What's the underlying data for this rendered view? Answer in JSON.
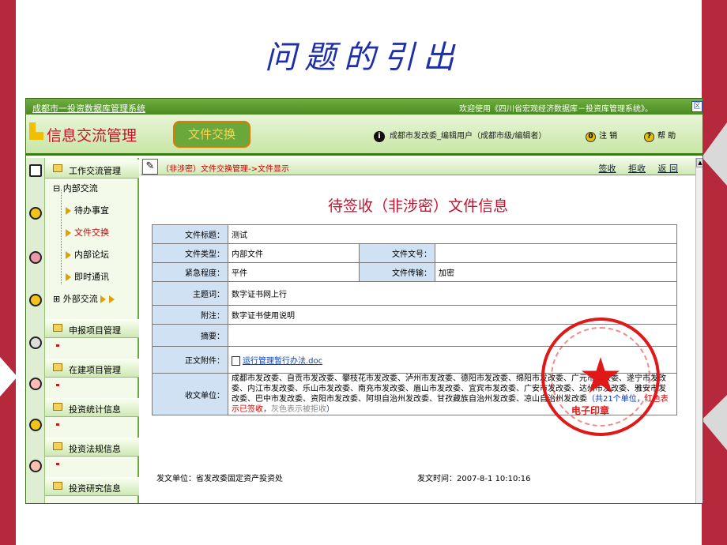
{
  "slide": {
    "title": "问题的引出"
  },
  "topbar": {
    "system_link": "成都市一投资数据库管理系统",
    "welcome": "欢迎使用《四川省宏观经济数据库－投资库管理系统》。",
    "window_btn": "区"
  },
  "header": {
    "app_title": "信息交流管理",
    "tab_label": "文件交换",
    "user_info": "成都市发改委_编辑用户（成都市级/编辑者）",
    "logout": "注 销",
    "help": "帮 助",
    "info_glyph": "i",
    "logout_glyph": "0",
    "help_glyph": "?"
  },
  "sidebar": {
    "groups": [
      "工作交流管理",
      "申报项目管理",
      "在建项目管理",
      "投资统计信息",
      "投资法规信息",
      "投资研究信息"
    ],
    "tree": {
      "internal": "内部交流",
      "items": [
        "待办事宜",
        "文件交换",
        "内部论坛",
        "即时通讯"
      ],
      "external": "外部交流"
    }
  },
  "crumbbar": {
    "breadcrumb": "（非涉密）文件交换管理->文件显示",
    "actions": [
      "签收",
      "拒收",
      "返 回"
    ]
  },
  "document": {
    "heading": "待签收（非涉密）文件信息",
    "rows": {
      "title_label": "文件标题：",
      "title_value": "测试",
      "type_label": "文件类型：",
      "type_value": "内部文件",
      "docno_label": "文件文号：",
      "docno_value": "",
      "urgency_label": "紧急程度：",
      "urgency_value": "平件",
      "trans_label": "文件传输：",
      "trans_value": "加密",
      "subject_label": "主题词：",
      "subject_value": "数字证书网上行",
      "note_label": "附注：",
      "note_value": "数字证书使用说明",
      "abstract_label": "摘要：",
      "abstract_value": "",
      "attach_label": "正文附件：",
      "attach_value": "运行管理暂行办法.doc",
      "recv_label": "收文单位：",
      "recv_value": "成都市发改委、自贡市发改委、攀枝花市发改委、泸州市发改委、德阳市发改委、绵阳市发改委、广元市发改委、遂宁市发改委、内江市发改委、乐山市发改委、南充市发改委、眉山市发改委、宜宾市发改委、广安市发改委、达州市发改委、雅安市发改委、巴中市发改委、资阳市发改委、阿坝自治州发改委、甘孜藏族自治州发改委、凉山自治州发改委",
      "legend_prefix": "（共21个单位，",
      "legend_red": "红色表示已签收",
      "legend_mid": "，",
      "legend_gray": "灰色表示被拒收",
      "legend_suffix": "）"
    },
    "issuer": "发文单位：省发改委固定资产投资处",
    "issue_time": "发文时间：2007-8-1 10:10:16"
  },
  "seal": {
    "text": "电子印章"
  },
  "colors": {
    "accent_red": "#c8102e",
    "accent_green": "#4a8a22",
    "label_blue": "#cfe1f3",
    "slide_stripe": "#b6283c"
  }
}
